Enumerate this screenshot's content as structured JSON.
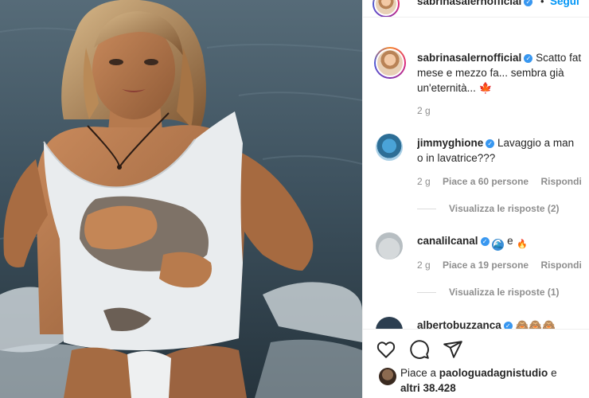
{
  "header": {
    "username": "sabrinasalernofficial",
    "dot": "•",
    "follow_label": "Segui"
  },
  "caption": {
    "username": "sabrinasalernofficial",
    "text_line1": "Scatto fat",
    "text_line2": "mese e mezzo fa... sembra già",
    "text_line3": "un'eternità...",
    "emoji": "🍁",
    "time": "2 g"
  },
  "comments": [
    {
      "username": "jimmyghione",
      "text_line1": "Lavaggio a man",
      "text_line2": "o in lavatrice???",
      "time": "2 g",
      "likes": "Piace a 60 persone",
      "reply_label": "Rispondi",
      "view_replies": "Visualizza le risposte (2)"
    },
    {
      "username": "canalilcanal",
      "text_mid": "e",
      "emoji1": "🌊",
      "emoji2": "🔥",
      "time": "2 g",
      "likes": "Piace a 19 persone",
      "reply_label": "Rispondi",
      "view_replies": "Visualizza le risposte (1)"
    },
    {
      "username": "albertobuzzanca",
      "emojis": "🙈🙈🙈"
    }
  ],
  "actions": {
    "likes_prefix": "Piace a",
    "likes_user": "paologuadagnistudio",
    "likes_suffix": "e",
    "likes_others": "altri 38.428"
  },
  "colors": {
    "accent": "#0095f6",
    "verified": "#3897f0",
    "muted": "#8e8e8e"
  },
  "icons": [
    "heart-icon",
    "comment-icon",
    "share-icon",
    "verified-icon",
    "maple-leaf-icon"
  ]
}
